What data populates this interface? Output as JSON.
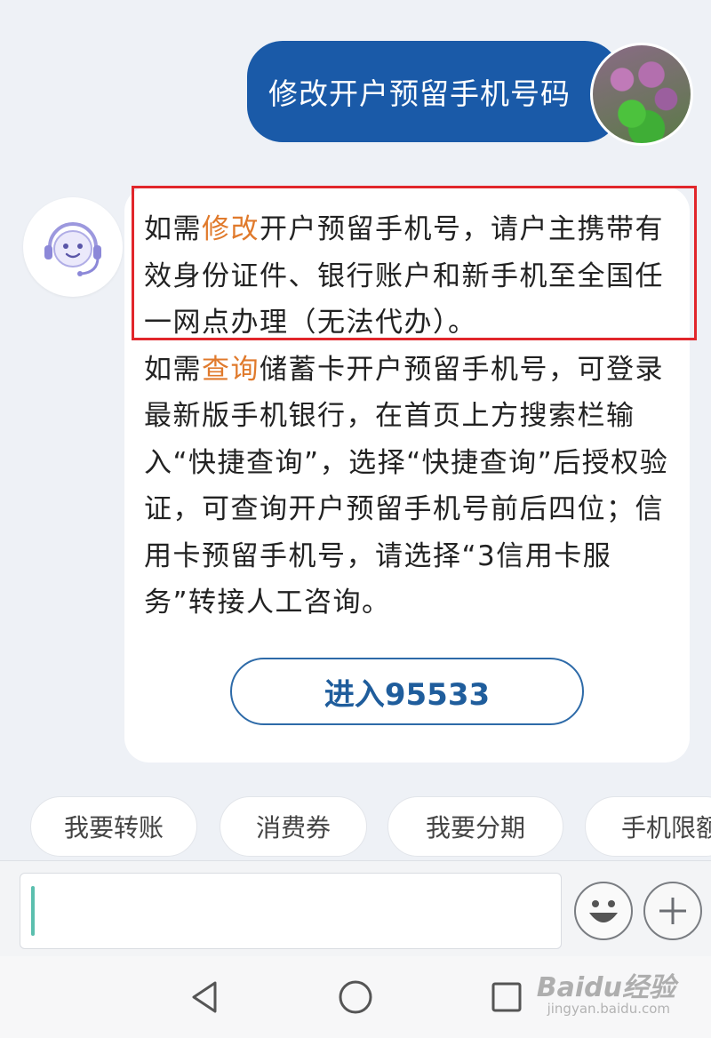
{
  "user_message": {
    "text": "修改开户预留手机号码"
  },
  "bot_message": {
    "p1_before": "如需",
    "p1_highlight": "修改",
    "p1_after": "开户预留手机号，请户主携带有效身份证件、银行账户和新手机至全国任一网点办理（无法代办）。",
    "p2_before": "如需",
    "p2_highlight": "查询",
    "p2_after": "储蓄卡开户预留手机号，可登录最新版手机银行，在首页上方搜索栏输入“快捷查询”，选择“快捷查询”后授权验证，可查询开户预留手机号前后四位；信用卡预留手机号，请选择“3信用卡服务”转接人工咨询。",
    "button_label": "进入95533",
    "highlight_color": "#e07a2c"
  },
  "quick_replies": [
    "我要转账",
    "消费券",
    "我要分期",
    "手机限额"
  ],
  "input": {
    "value": "",
    "emoji_icon": "smiley-icon",
    "add_icon": "plus-icon"
  },
  "watermark": {
    "brand": "Baidu经验",
    "url": "jingyan.baidu.com"
  },
  "colors": {
    "user_bubble": "#1a5aa8",
    "button_border": "#2d6aa8",
    "annotation_box": "#e1262b"
  }
}
